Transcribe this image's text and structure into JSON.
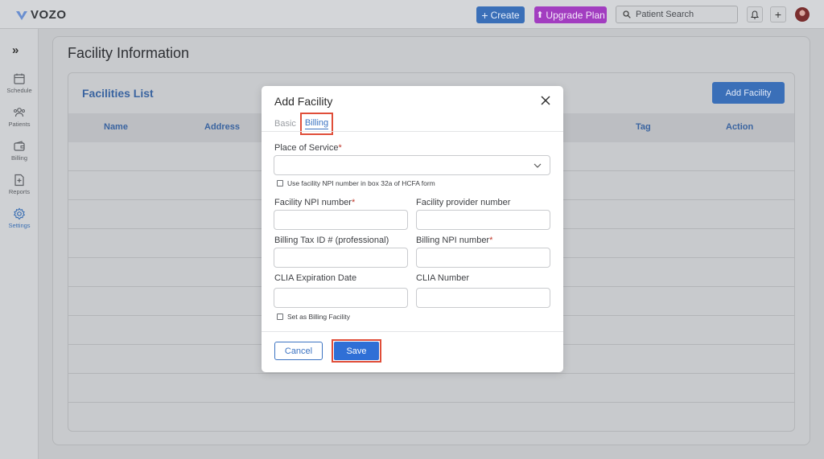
{
  "app": {
    "name": "VOZO"
  },
  "topbar": {
    "create_label": "Create",
    "upgrade_label": "Upgrade Plan",
    "search_placeholder": "Patient Search"
  },
  "sidebar": {
    "items": [
      {
        "label": "Schedule",
        "icon": "calendar-icon"
      },
      {
        "label": "Patients",
        "icon": "users-icon"
      },
      {
        "label": "Billing",
        "icon": "wallet-icon"
      },
      {
        "label": "Reports",
        "icon": "report-icon"
      },
      {
        "label": "Settings",
        "icon": "gear-icon",
        "active": true
      }
    ]
  },
  "page": {
    "title": "Facility Information",
    "list_title": "Facilities List",
    "add_button": "Add Facility",
    "columns": [
      "Name",
      "Address",
      "Tag",
      "Action"
    ]
  },
  "modal": {
    "title": "Add Facility",
    "tabs": [
      "Basic",
      "Billing"
    ],
    "active_tab": "Billing",
    "place_of_service_label": "Place of Service",
    "place_of_service_value": "",
    "npi_box_checkbox": "Use facility NPI number in box 32a of HCFA form",
    "facility_npi_label": "Facility NPI number",
    "facility_provider_label": "Facility provider number",
    "billing_tax_label": "Billing Tax ID # (professional)",
    "billing_npi_label": "Billing NPI number",
    "clia_exp_label": "CLIA Expiration Date",
    "clia_number_label": "CLIA Number",
    "billing_facility_checkbox": "Set as Billing Facility",
    "cancel_label": "Cancel",
    "save_label": "Save",
    "required_mark": "*"
  },
  "colors": {
    "accent": "#2f6fd6",
    "highlight": "#e04e39",
    "upgrade": "#a23dc0"
  }
}
